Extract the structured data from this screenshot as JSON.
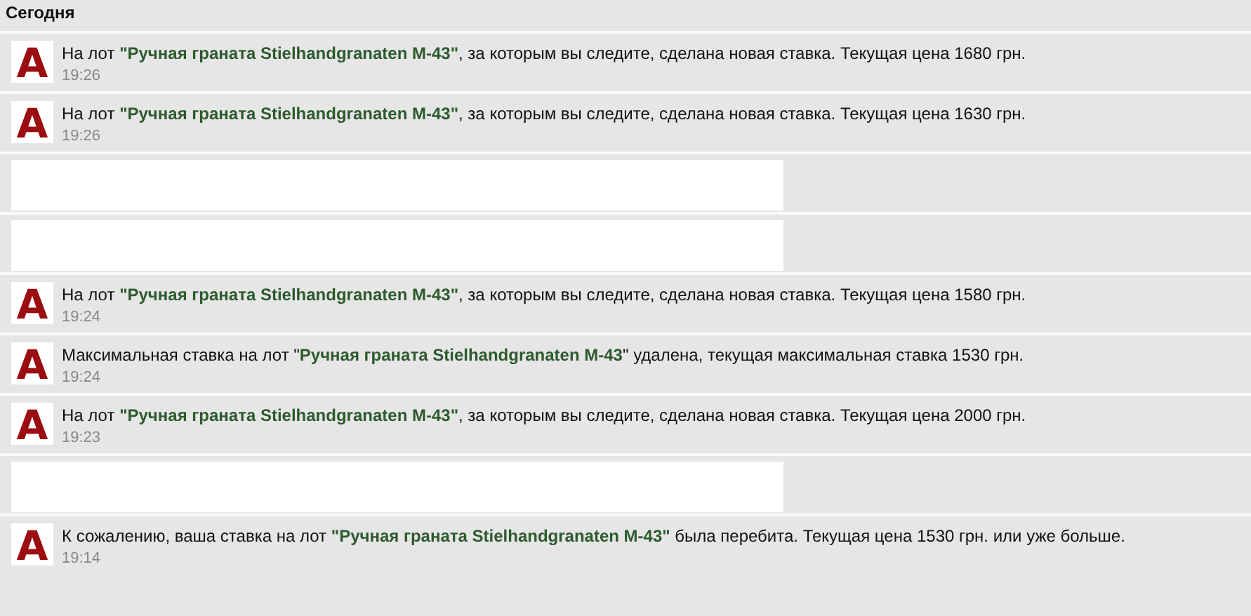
{
  "heading": "Сегодня",
  "notifications": [
    {
      "kind": "notice",
      "logo": "A",
      "text": "На лот **\"Ручная граната Stielhandgranaten M-43\"**, за которым вы следите, сделана новая ставка. Текущая цена 1680 грн.",
      "time": "19:26"
    },
    {
      "kind": "notice",
      "logo": "A",
      "text": "На лот **\"Ручная граната Stielhandgranaten M-43\"**, за которым вы следите, сделана новая ставка. Текущая цена 1630 грн.",
      "time": "19:26"
    },
    {
      "kind": "redacted"
    },
    {
      "kind": "redacted"
    },
    {
      "kind": "notice",
      "logo": "A",
      "text": "На лот **\"Ручная граната Stielhandgranaten M-43\"**, за которым вы следите, сделана новая ставка. Текущая цена 1580 грн.",
      "time": "19:24"
    },
    {
      "kind": "notice",
      "logo": "A",
      "text": "Максимальная ставка на лот \"**Ручная граната Stielhandgranaten M-43**\" удалена, текущая максимальная ставка 1530 грн.",
      "time": "19:24"
    },
    {
      "kind": "notice",
      "logo": "A",
      "text": "На лот **\"Ручная граната Stielhandgranaten M-43\"**, за которым вы следите, сделана новая ставка. Текущая цена 2000 грн.",
      "time": "19:23"
    },
    {
      "kind": "redacted"
    },
    {
      "kind": "notice",
      "logo": "A",
      "text": "К сожалению, ваша ставка на лот **\"Ручная граната Stielhandgranaten M-43\"** была перебита. Текущая цена 1530 грн. или уже больше.",
      "time": "19:14"
    }
  ]
}
